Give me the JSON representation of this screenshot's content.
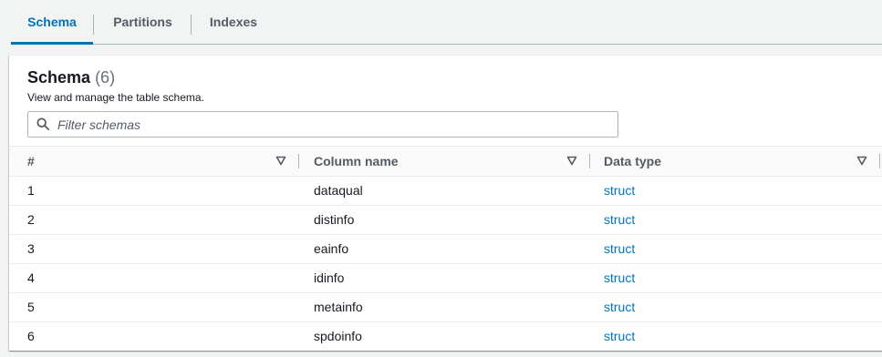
{
  "tabs": [
    {
      "label": "Schema",
      "active": true
    },
    {
      "label": "Partitions",
      "active": false
    },
    {
      "label": "Indexes",
      "active": false
    }
  ],
  "panel": {
    "title": "Schema",
    "count": "(6)",
    "description": "View and manage the table schema.",
    "search_placeholder": "Filter schemas"
  },
  "table": {
    "columns": [
      "#",
      "Column name",
      "Data type"
    ],
    "rows": [
      {
        "num": "1",
        "name": "dataqual",
        "type": "struct"
      },
      {
        "num": "2",
        "name": "distinfo",
        "type": "struct"
      },
      {
        "num": "3",
        "name": "eainfo",
        "type": "struct"
      },
      {
        "num": "4",
        "name": "idinfo",
        "type": "struct"
      },
      {
        "num": "5",
        "name": "metainfo",
        "type": "struct"
      },
      {
        "num": "6",
        "name": "spdoinfo",
        "type": "struct"
      }
    ]
  },
  "colors": {
    "accent": "#0073bb",
    "text": "#16191f",
    "muted": "#545b64",
    "background": "#f2f3f3"
  },
  "icons": {
    "search": "search-icon",
    "sort": "sort-caret-down-icon"
  }
}
